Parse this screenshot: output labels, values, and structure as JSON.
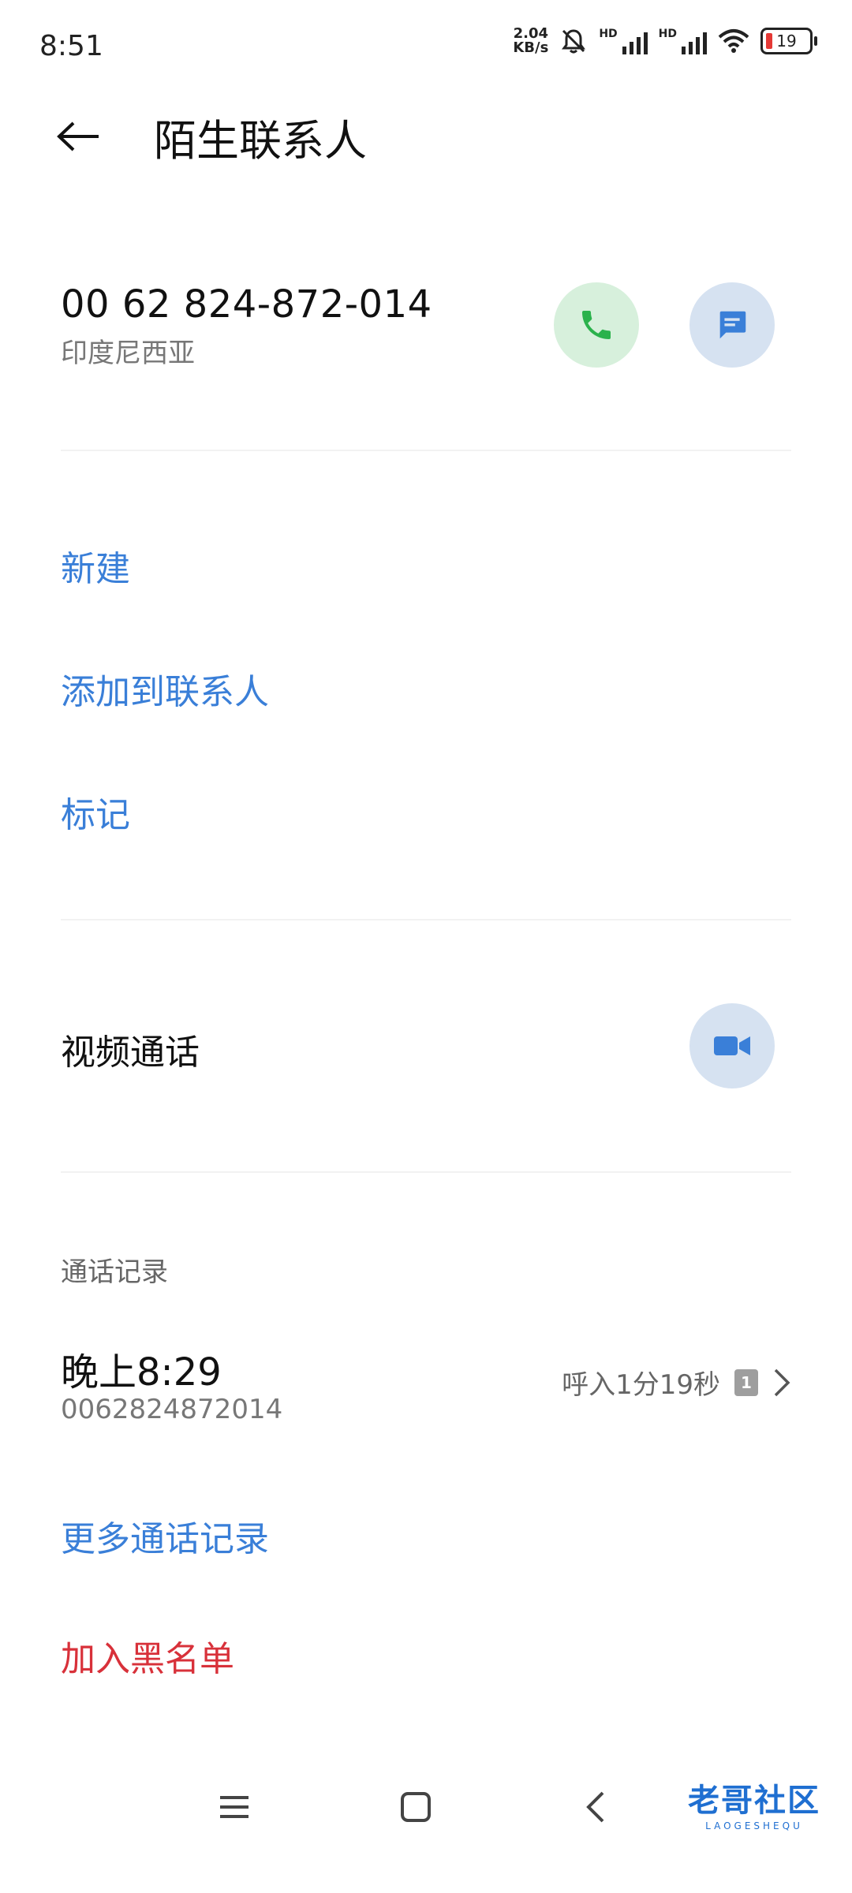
{
  "status_bar": {
    "time": "8:51",
    "net_speed_value": "2.04",
    "net_speed_unit": "KB/s",
    "hd_label_1": "HD",
    "hd_label_2": "HD",
    "battery_level": "19"
  },
  "header": {
    "title": "陌生联系人"
  },
  "contact": {
    "number": "00 62 824-872-014",
    "region": "印度尼西亚"
  },
  "actions": {
    "new": "新建",
    "add_to_contacts": "添加到联系人",
    "mark": "标记"
  },
  "video": {
    "label": "视频通话"
  },
  "call_log": {
    "section_label": "通话记录",
    "entry": {
      "time": "晚上8:29",
      "number": "0062824872014",
      "detail": "呼入1分19秒",
      "sim": "1"
    },
    "more": "更多通话记录"
  },
  "blacklist": "加入黑名单",
  "watermark": {
    "text": "老哥社区",
    "sub": "LAOGESHEQU"
  },
  "colors": {
    "accent": "#3a7fd8",
    "danger": "#d8313a",
    "call_green": "#2bb24c"
  }
}
